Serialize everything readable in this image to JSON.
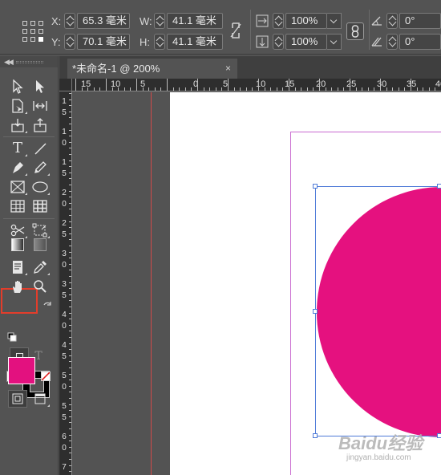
{
  "control_panel": {
    "x_label": "X:",
    "x_value": "65.3 毫米",
    "y_label": "Y:",
    "y_value": "70.1 毫米",
    "w_label": "W:",
    "w_value": "41.1 毫米",
    "h_label": "H:",
    "h_value": "41.1 毫米",
    "scale_x_value": "100%",
    "scale_y_value": "100%",
    "rotate_value": "0°",
    "shear_value": "0°"
  },
  "document_tab": {
    "title": "*未命名-1 @ 200%",
    "close_glyph": "×"
  },
  "ruler_h_labels": [
    "15",
    "10",
    "5",
    "0",
    "5",
    "10",
    "15",
    "20",
    "25",
    "30",
    "35",
    "40"
  ],
  "ruler_v_labels": [
    "1",
    "5",
    "1",
    "0",
    "1",
    "5",
    "2",
    "0",
    "2",
    "5",
    "3",
    "0",
    "3",
    "5",
    "4",
    "0",
    "4",
    "5",
    "5",
    "0",
    "5",
    "5",
    "6",
    "0",
    "6",
    "5",
    "7",
    "0"
  ],
  "toolbar": {
    "type_glyph": "T",
    "container_type_glyph": "T"
  },
  "swatches": {
    "fill_color": "#e3117f",
    "stroke_color": "#000000"
  },
  "object": {
    "fill_color": "#e5117f",
    "selection_color": "#4f7bd8"
  },
  "watermark": {
    "logo_text": "Baidu经验",
    "url_text": "jingyan.baidu.com"
  }
}
